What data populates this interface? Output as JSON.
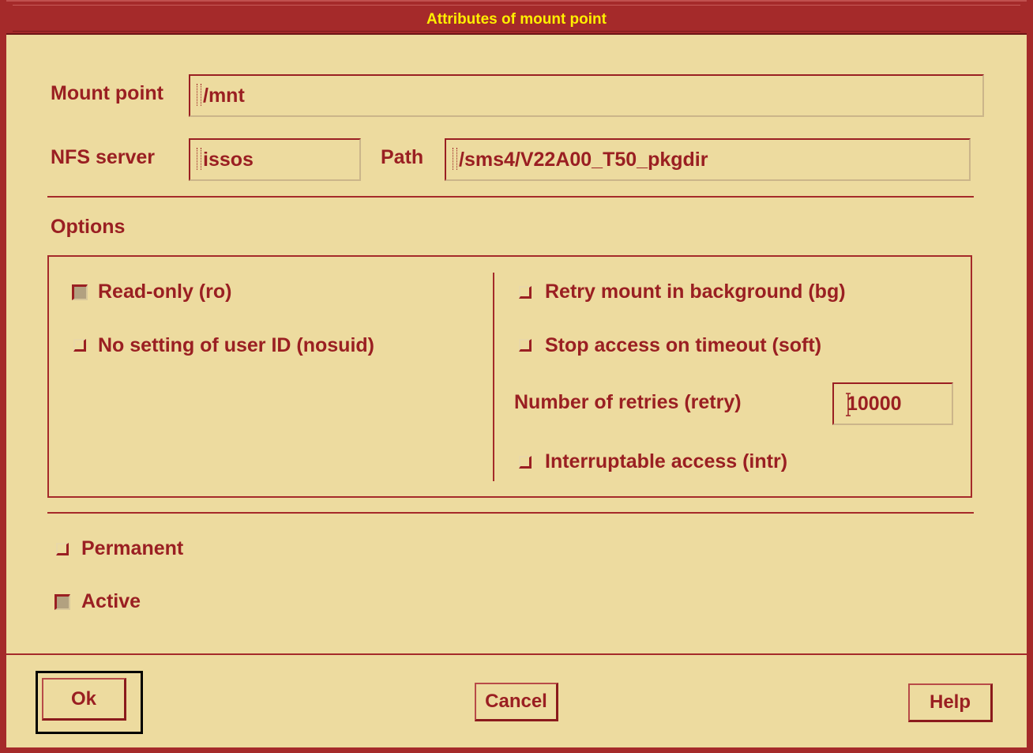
{
  "window": {
    "title": "Attributes of mount point"
  },
  "fields": {
    "mount_point": {
      "label": "Mount point",
      "value": "/mnt"
    },
    "nfs_server": {
      "label": "NFS server",
      "value": "issos"
    },
    "path": {
      "label": "Path",
      "value": "/sms4/V22A00_T50_pkgdir"
    }
  },
  "options": {
    "heading": "Options",
    "read_only": {
      "label": "Read-only (ro)",
      "checked": true
    },
    "nosuid": {
      "label": "No setting of user ID (nosuid)",
      "checked": false
    },
    "bg": {
      "label": "Retry mount in background (bg)",
      "checked": false
    },
    "soft": {
      "label": "Stop access on timeout (soft)",
      "checked": false
    },
    "retry": {
      "label": "Number of retries (retry)",
      "value": "10000"
    },
    "intr": {
      "label": "Interruptable access (intr)",
      "checked": false
    }
  },
  "permanent": {
    "label": "Permanent",
    "checked": false
  },
  "active": {
    "label": "Active",
    "checked": true
  },
  "buttons": {
    "ok": "Ok",
    "cancel": "Cancel",
    "help": "Help"
  },
  "colors": {
    "frame": "#a52a2a",
    "background": "#eddb9f",
    "text": "#9a1f22",
    "title_text": "#ffef00"
  }
}
